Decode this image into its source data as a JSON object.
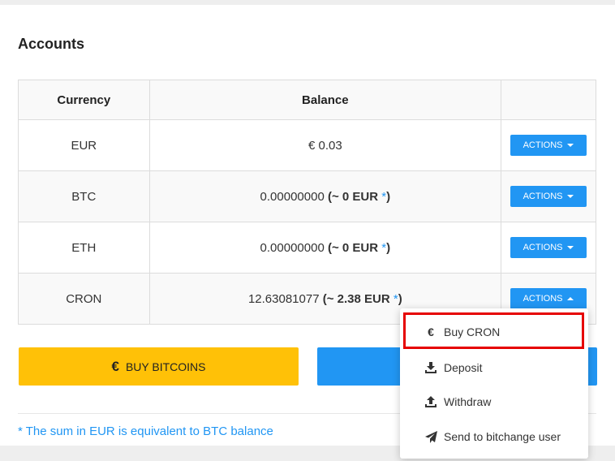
{
  "page": {
    "title": "Accounts"
  },
  "table": {
    "headers": [
      "Currency",
      "Balance",
      ""
    ],
    "rows": [
      {
        "currency": "EUR",
        "balance_prefix": "€ 0.03",
        "approx": "",
        "star": "",
        "suffix": "",
        "action": "ACTIONS",
        "open": false
      },
      {
        "currency": "BTC",
        "balance_prefix": "0.00000000",
        "open_paren": "(",
        "approx": "~ 0 EUR",
        "star": "*",
        "suffix": ")",
        "action": "ACTIONS",
        "open": false
      },
      {
        "currency": "ETH",
        "balance_prefix": "0.00000000",
        "open_paren": "(",
        "approx": "~ 0 EUR",
        "star": "*",
        "suffix": ")",
        "action": "ACTIONS",
        "open": false
      },
      {
        "currency": "CRON",
        "balance_prefix": "12.63081077",
        "open_paren": "(",
        "approx": "~ 2.38 EUR",
        "star": "*",
        "suffix": ")",
        "action": "ACTIONS",
        "open": true
      }
    ]
  },
  "buttons": {
    "buy_bitcoins": "BUY BITCOINS",
    "euro_symbol": "€"
  },
  "footnote": "* The sum in EUR is equivalent to BTC balance",
  "dropdown": {
    "items": [
      {
        "label": "Buy CRON",
        "icon": "euro-icon",
        "glyph": "€"
      },
      {
        "label": "Deposit",
        "icon": "download-icon"
      },
      {
        "label": "Withdraw",
        "icon": "upload-icon"
      },
      {
        "label": "Send to bitchange user",
        "icon": "send-icon"
      }
    ]
  },
  "colors": {
    "primary": "#2196f3",
    "warning": "#ffc107",
    "highlight": "#e60000"
  }
}
